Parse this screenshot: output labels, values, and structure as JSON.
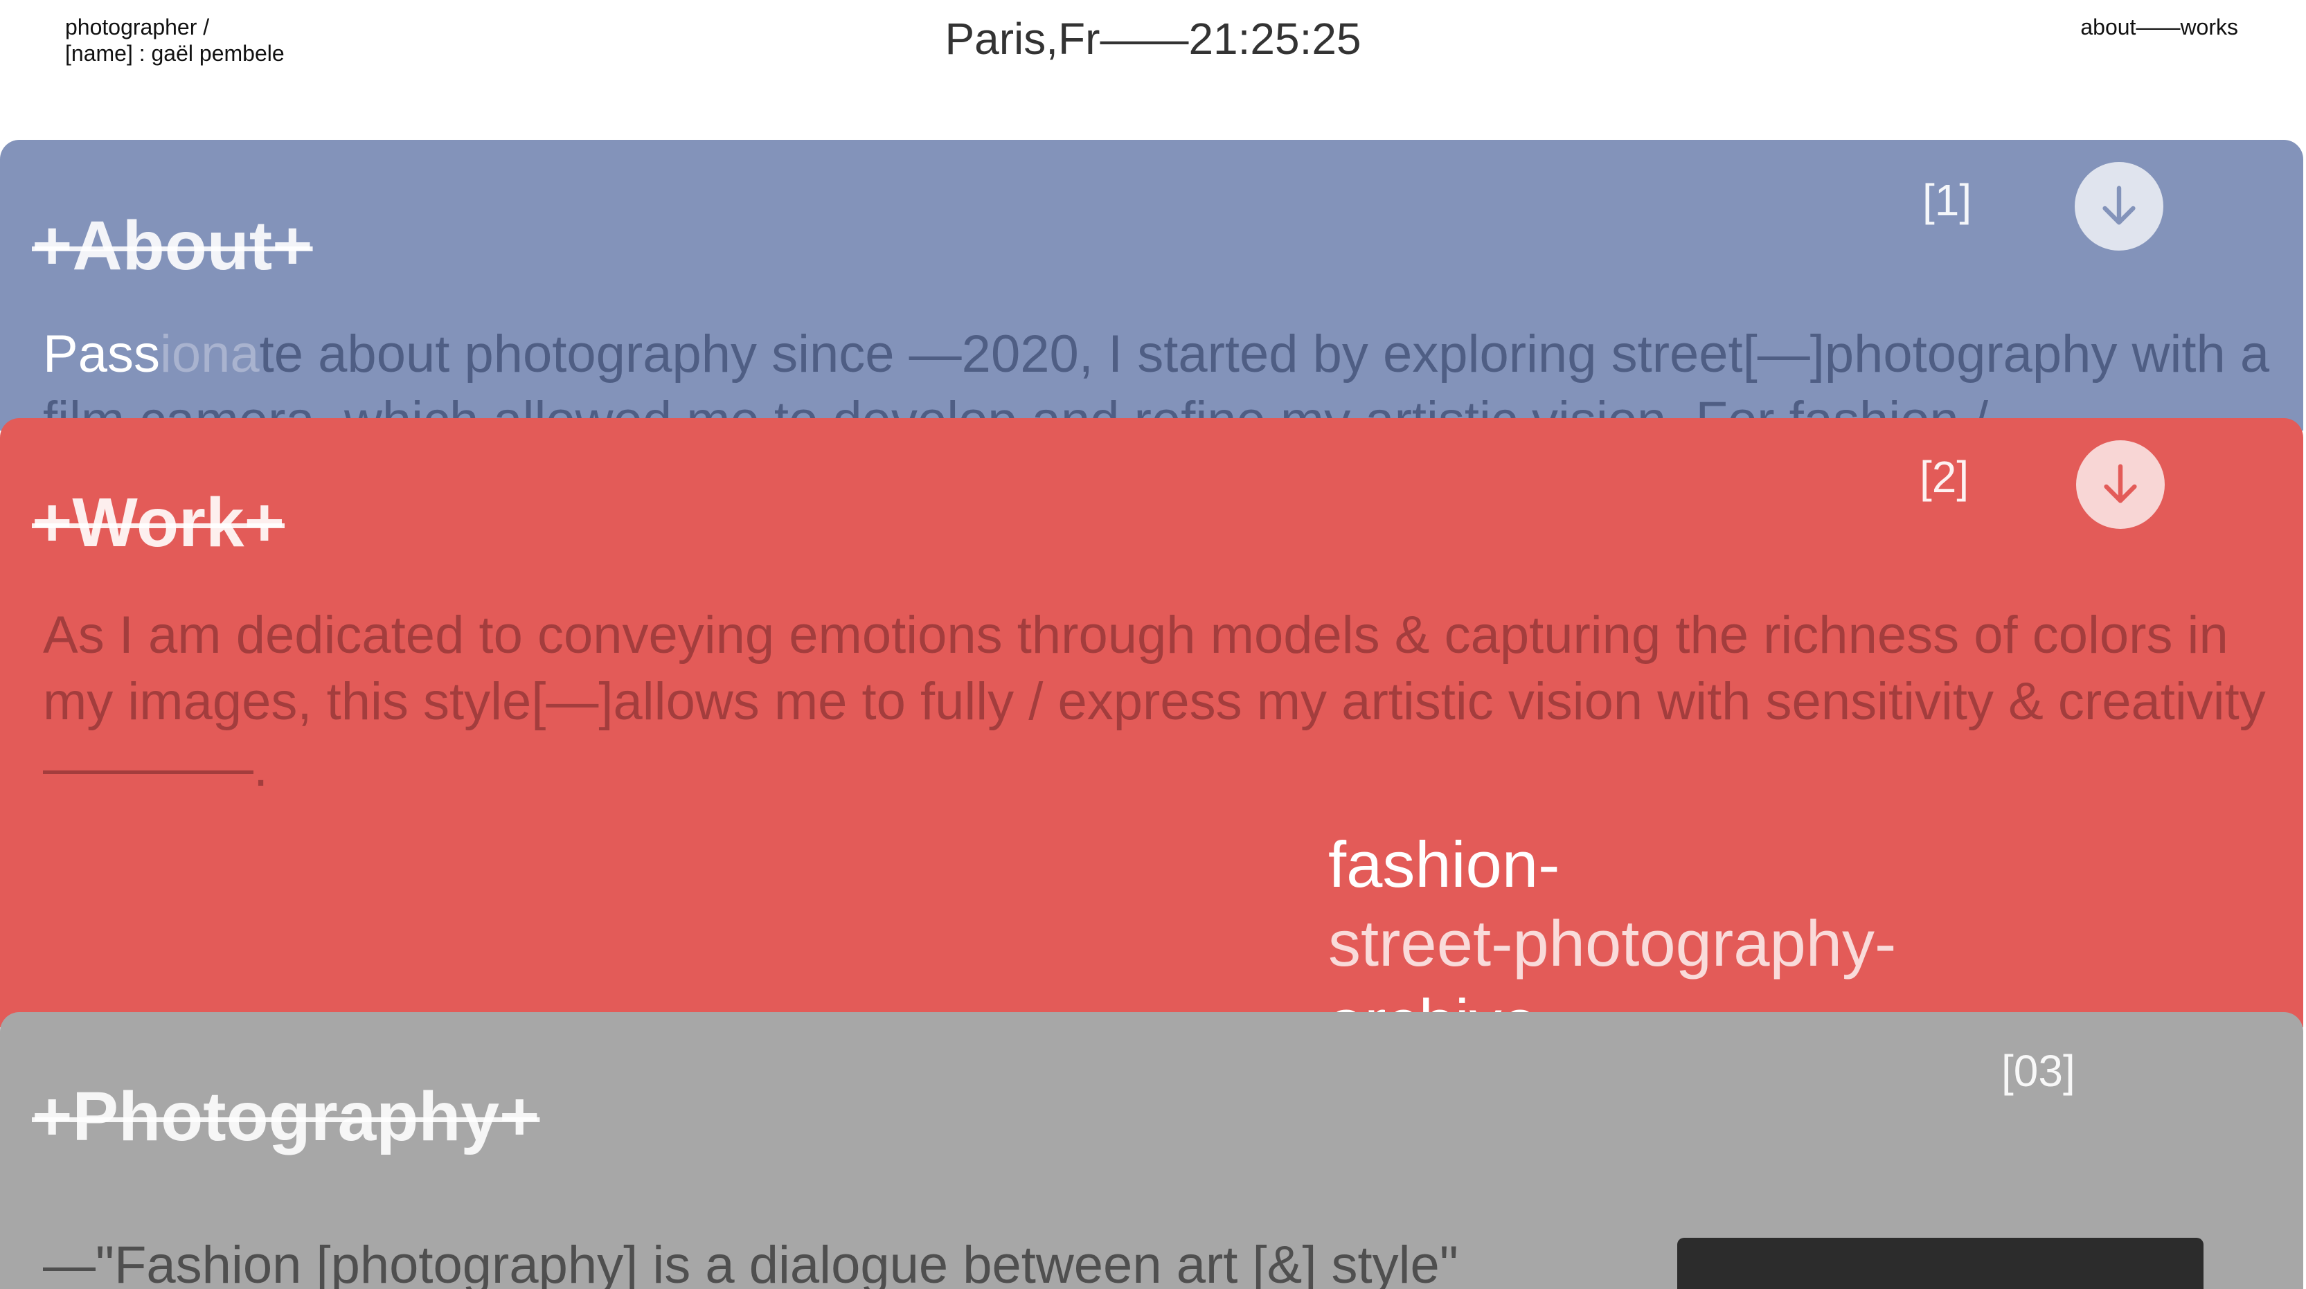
{
  "header": {
    "left_line1": "photographer /",
    "left_line2": "[name] : gaël pembele",
    "center": "Paris,Fr——21:25:25",
    "right": "about——works"
  },
  "panels": {
    "about": {
      "title": "+About+",
      "index": "[1]",
      "text_hl": "Pass",
      "text_hl2": "iona",
      "text_rest": "te about photography since —2020, I started by exploring street[—]photography with a film camera, which allowed me to develop and refine my artistic vision. For fashion /"
    },
    "work": {
      "title": "+Work+",
      "index": "[2]",
      "text": "As I am dedicated to conveying emotions through models & capturing the richness of colors in my images, this style[—]allows me to fully / express my artistic vision with sensitivity & creativity————.",
      "tags": [
        "fashion-",
        "street-photography-",
        "archive-"
      ]
    },
    "photo": {
      "title": "+Photography+",
      "index": "[03]",
      "text": "—\"Fashion [photography] is a dialogue between art [&] style\""
    }
  },
  "colors": {
    "about_bg": "#8393BA",
    "work_bg": "#E35B58",
    "photo_bg": "#A7A7A7"
  }
}
